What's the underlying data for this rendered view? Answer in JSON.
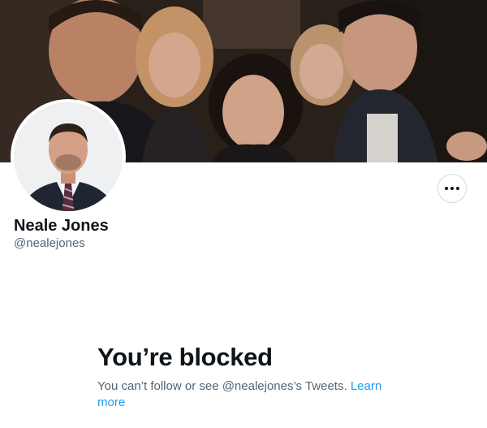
{
  "profile": {
    "name": "Neale Jones",
    "handle": "@nealejones",
    "banner_alt": "group photo header",
    "avatar_alt": "profile photo"
  },
  "actions": {
    "more_icon": "more-horizontal-icon"
  },
  "blocked": {
    "title": "You’re blocked",
    "message": "You can’t follow or see @nealejones’s Tweets.",
    "link_label": "Learn more"
  },
  "colors": {
    "link": "#1d9bf0",
    "text_primary": "#0f1419",
    "text_secondary": "#536471",
    "border": "#cfd9de"
  }
}
